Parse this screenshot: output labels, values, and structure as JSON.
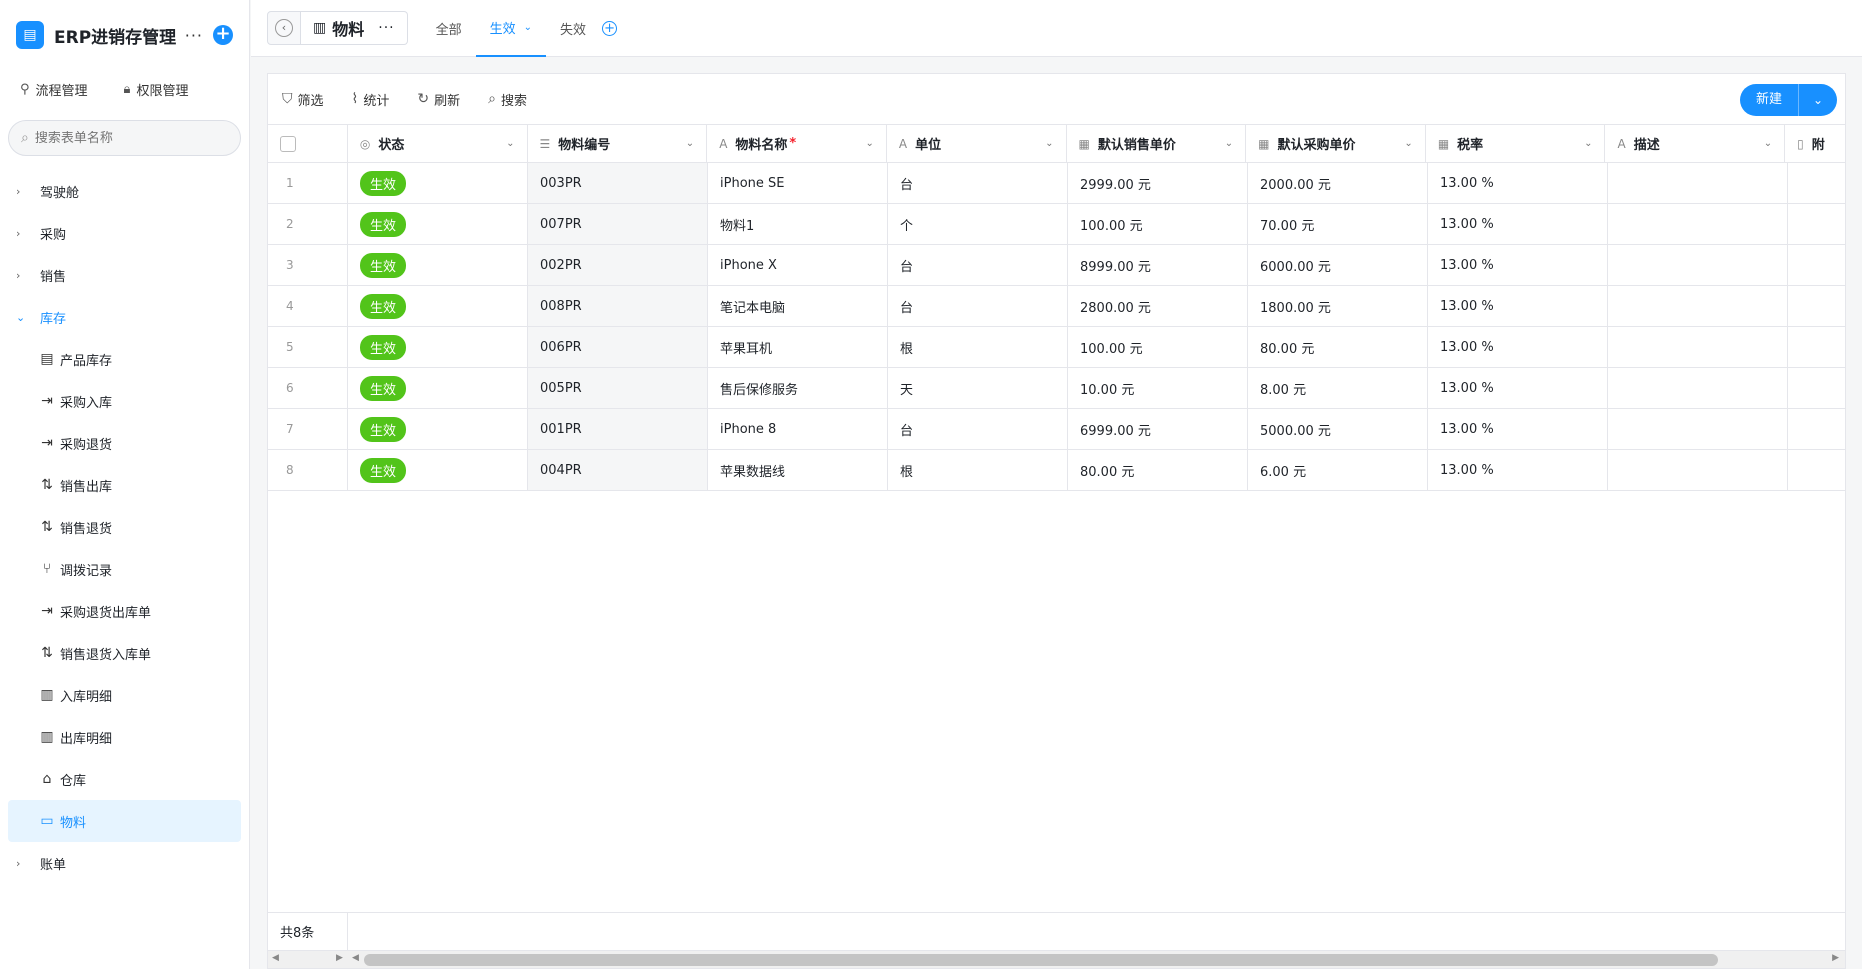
{
  "app": {
    "title": "ERP进销存管理",
    "more": "···",
    "add": "+"
  },
  "top_links": [
    {
      "label": "流程管理",
      "icon": "workflow-icon"
    },
    {
      "label": "权限管理",
      "icon": "lock-icon"
    }
  ],
  "search": {
    "placeholder": "搜索表单名称"
  },
  "nav": {
    "groups_before": [
      "驾驶舱",
      "采购",
      "销售"
    ],
    "open_group": "库存",
    "items": [
      {
        "label": "产品库存",
        "icon": "inventory-icon"
      },
      {
        "label": "采购入库",
        "icon": "arrow-in-icon"
      },
      {
        "label": "采购退货",
        "icon": "arrow-in-icon"
      },
      {
        "label": "销售出库",
        "icon": "sort-up-icon"
      },
      {
        "label": "销售退货",
        "icon": "sort-up-icon"
      },
      {
        "label": "调拨记录",
        "icon": "branch-icon"
      },
      {
        "label": "采购退货出库单",
        "icon": "arrow-in-icon"
      },
      {
        "label": "销售退货入库单",
        "icon": "sort-up-icon"
      },
      {
        "label": "入库明细",
        "icon": "gallery-icon"
      },
      {
        "label": "出库明细",
        "icon": "gallery-icon"
      },
      {
        "label": "仓库",
        "icon": "warehouse-icon"
      },
      {
        "label": "物料",
        "icon": "box-icon",
        "active": true
      }
    ],
    "groups_after": [
      "账单"
    ]
  },
  "header": {
    "page_title": "物料",
    "page_more": "···",
    "tabs": [
      {
        "label": "全部",
        "active": false
      },
      {
        "label": "生效",
        "active": true
      },
      {
        "label": "失效",
        "active": false
      }
    ]
  },
  "toolbar": {
    "filter": "筛选",
    "stats": "统计",
    "refresh": "刷新",
    "search": "搜索",
    "new": "新建"
  },
  "table": {
    "columns": [
      {
        "label": "状态",
        "icon": "status-icon"
      },
      {
        "label": "物料编号",
        "icon": "number-icon"
      },
      {
        "label": "物料名称",
        "icon": "text-icon",
        "required": "*"
      },
      {
        "label": "单位",
        "icon": "text-icon"
      },
      {
        "label": "默认销售单价",
        "icon": "money-icon"
      },
      {
        "label": "默认采购单价",
        "icon": "money-icon"
      },
      {
        "label": "税率",
        "icon": "money-icon"
      },
      {
        "label": "描述",
        "icon": "text-icon"
      },
      {
        "label": "附",
        "icon": "file-icon"
      }
    ],
    "rows": [
      [
        "1",
        "生效",
        "003PR",
        "iPhone SE",
        "台",
        "2999.00 元",
        "2000.00 元",
        "13.00 %",
        ""
      ],
      [
        "2",
        "生效",
        "007PR",
        "物料1",
        "个",
        "100.00 元",
        "70.00 元",
        "13.00 %",
        ""
      ],
      [
        "3",
        "生效",
        "002PR",
        "iPhone X",
        "台",
        "8999.00 元",
        "6000.00 元",
        "13.00 %",
        ""
      ],
      [
        "4",
        "生效",
        "008PR",
        "笔记本电脑",
        "台",
        "2800.00 元",
        "1800.00 元",
        "13.00 %",
        ""
      ],
      [
        "5",
        "生效",
        "006PR",
        "苹果耳机",
        "根",
        "100.00 元",
        "80.00 元",
        "13.00 %",
        ""
      ],
      [
        "6",
        "生效",
        "005PR",
        "售后保修服务",
        "天",
        "10.00 元",
        "8.00 元",
        "13.00 %",
        ""
      ],
      [
        "7",
        "生效",
        "001PR",
        "iPhone 8",
        "台",
        "6999.00 元",
        "5000.00 元",
        "13.00 %",
        ""
      ],
      [
        "8",
        "生效",
        "004PR",
        "苹果数据线",
        "根",
        "80.00 元",
        "6.00 元",
        "13.00 %",
        ""
      ]
    ],
    "footer_count": "共8条"
  },
  "colors": {
    "accent": "#1890ff",
    "status_green": "#52c41a",
    "active_bg": "#e6f4ff"
  }
}
